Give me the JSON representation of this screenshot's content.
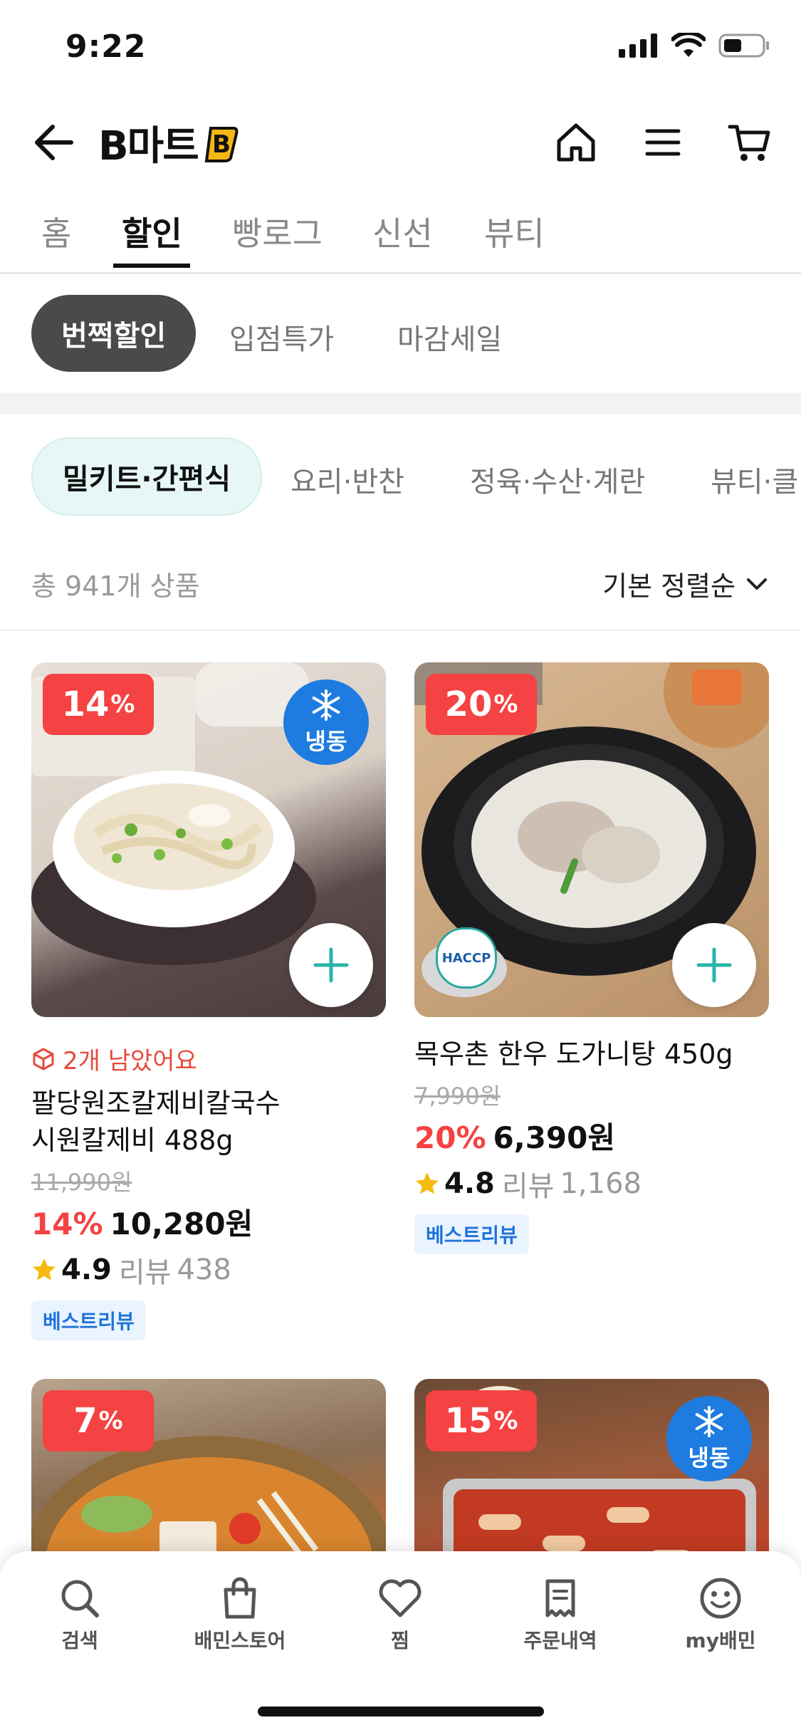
{
  "status": {
    "time": "9:22"
  },
  "header": {
    "brand": "B마트",
    "badge": "B"
  },
  "tabs": [
    "홈",
    "할인",
    "빵로그",
    "신선",
    "뷰티"
  ],
  "subtabs": {
    "active": "번쩍할인",
    "others": [
      "입점특가",
      "마감세일"
    ]
  },
  "categories": [
    "밀키트·간편식",
    "요리·반찬",
    "정육·수산·계란",
    "뷰티·클"
  ],
  "list": {
    "count_label": "총 941개 상품",
    "sort_label": "기본 정렬순"
  },
  "products": [
    {
      "discount_num": "14",
      "discount_pct": "%",
      "frozen_label": "냉동",
      "stock_label": "2개 남았어요",
      "name_line1": "팔당원조칼제비칼국수",
      "name_line2": "시원칼제비 488g",
      "original_price": "11,990원",
      "rate": "14%",
      "price": "10,280원",
      "score": "4.9",
      "review_label": "리뷰",
      "review_count": "438",
      "tag": "베스트리뷰"
    },
    {
      "discount_num": "20",
      "discount_pct": "%",
      "haccp_label": "HACCP",
      "name": "목우촌 한우 도가니탕 450g",
      "original_price": "7,990원",
      "rate": "20%",
      "price": "6,390원",
      "score": "4.8",
      "review_label": "리뷰",
      "review_count": "1,168",
      "tag": "베스트리뷰"
    },
    {
      "discount_num": "7",
      "discount_pct": "%"
    },
    {
      "discount_num": "15",
      "discount_pct": "%",
      "frozen_label": "냉동"
    }
  ],
  "bottom_nav": [
    "검색",
    "배민스토어",
    "찜",
    "주문내역",
    "my배민"
  ],
  "colors": {
    "discount_red": "#f54242",
    "frozen_blue": "#1e7be0",
    "mint": "#28b5ab",
    "best_blue": "#1f73d9"
  }
}
